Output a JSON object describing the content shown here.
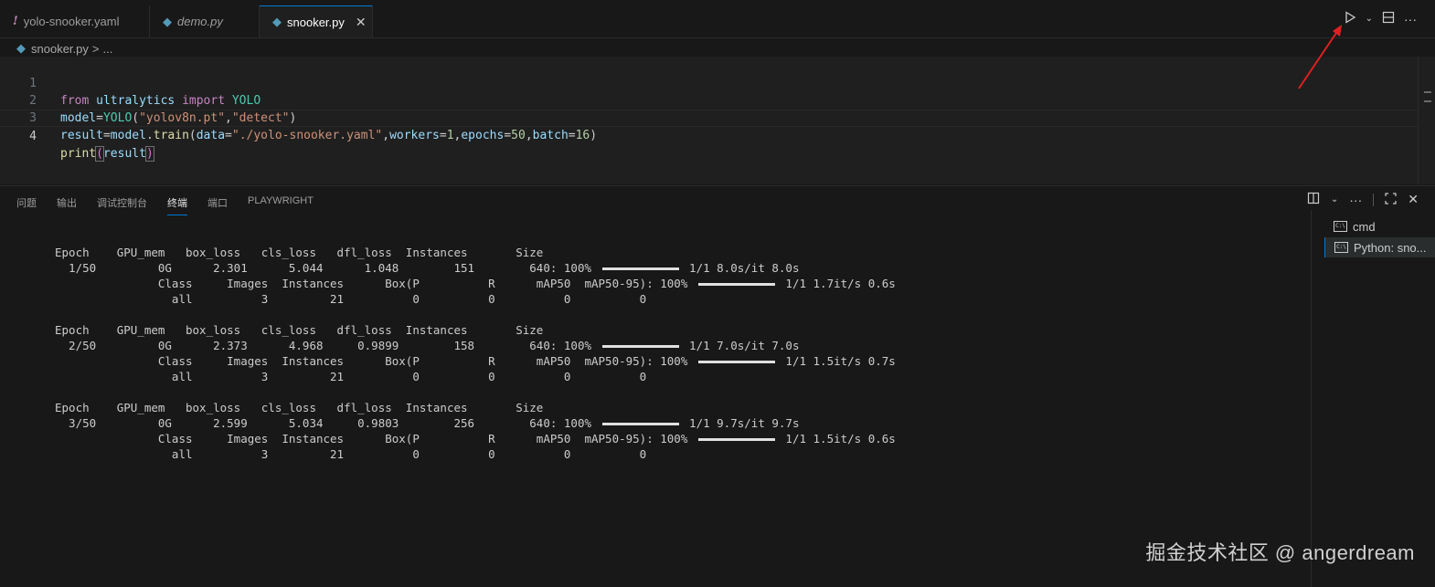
{
  "tabs": [
    {
      "label": "yolo-snooker.yaml",
      "icon": "yaml-exclamation-icon"
    },
    {
      "label": "demo.py",
      "icon": "python-icon"
    },
    {
      "label": "snooker.py",
      "icon": "python-icon",
      "active": true
    }
  ],
  "tab_close_glyph": "✕",
  "breadcrumb": {
    "file": "snooker.py",
    "separator": ">",
    "tail": "..."
  },
  "editor": {
    "line_numbers": [
      "1",
      "2",
      "3",
      "4"
    ],
    "lines": [
      "from ultralytics import YOLO",
      "model=YOLO(\"yolov8n.pt\",\"detect\")",
      "result=model.train(data=\"./yolo-snooker.yaml\",workers=1,epochs=50,batch=16)",
      "print(result)"
    ]
  },
  "panel": {
    "tabs": [
      "问题",
      "输出",
      "调试控制台",
      "终端",
      "端口",
      "PLAYWRIGHT"
    ],
    "active_tab": "终端"
  },
  "terminal": {
    "lines": [
      "Epoch    GPU_mem   box_loss   cls_loss   dfl_loss  Instances       Size",
      "  1/50         0G      2.301      5.044      1.048        151        640: 100% |BAR| 1/1 8.0s/it 8.0s",
      "               Class     Images  Instances      Box(P          R      mAP50  mAP50-95): 100% |BAR| 1/1 1.7it/s 0.6s",
      "                 all          3         21          0          0          0          0",
      "",
      "Epoch    GPU_mem   box_loss   cls_loss   dfl_loss  Instances       Size",
      "  2/50         0G      2.373      4.968     0.9899        158        640: 100% |BAR| 1/1 7.0s/it 7.0s",
      "               Class     Images  Instances      Box(P          R      mAP50  mAP50-95): 100% |BAR| 1/1 1.5it/s 0.7s",
      "                 all          3         21          0          0          0          0",
      "",
      "Epoch    GPU_mem   box_loss   cls_loss   dfl_loss  Instances       Size",
      "  3/50         0G      2.599      5.034     0.9803        256        640: 100% |BAR| 1/1 9.7s/it 9.7s",
      "               Class     Images  Instances      Box(P          R      mAP50  mAP50-95): 100% |BAR| 1/1 1.5it/s 0.6s",
      "                 all          3         21          0          0          0          0"
    ],
    "progress_percent": 100
  },
  "terminal_list": [
    {
      "label": "cmd",
      "icon": "terminal-icon"
    },
    {
      "label": "Python: sno...",
      "icon": "terminal-icon",
      "active": true
    }
  ],
  "watermark": "掘金技术社区 @ angerdream",
  "colors": {
    "accent": "#0078d4",
    "annotation_arrow": "#e02020",
    "editor_bg": "#1f1f1f",
    "panel_bg": "#181818"
  }
}
